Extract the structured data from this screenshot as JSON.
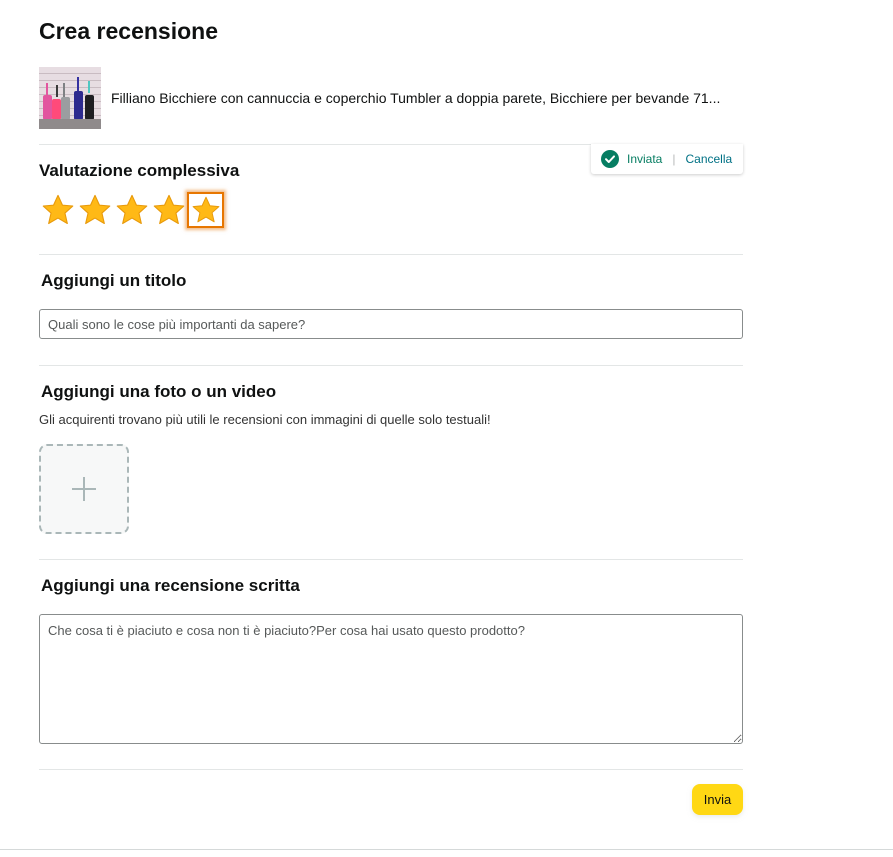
{
  "page": {
    "title": "Crea recensione"
  },
  "product": {
    "name": "Filliano Bicchiere con cannuccia e coperchio Tumbler a doppia parete, Bicchiere per bevande 71..."
  },
  "rating": {
    "title": "Valutazione complessiva",
    "value": 5,
    "max": 5,
    "status": "Inviata",
    "cancel_label": "Cancella",
    "separator": "|"
  },
  "title_section": {
    "heading": "Aggiungi un titolo",
    "placeholder": "Quali sono le cose più importanti da sapere?"
  },
  "media_section": {
    "heading": "Aggiungi una foto o un video",
    "helper": "Gli acquirenti trovano più utili le recensioni con immagini di quelle solo testuali!"
  },
  "written_section": {
    "heading": "Aggiungi una recensione scritta",
    "placeholder": "Che cosa ti è piaciuto e cosa non ti è piaciuto?Per cosa hai usato questo prodotto?"
  },
  "submit": {
    "label": "Invia"
  },
  "icons": {
    "status": "check-circle-icon",
    "upload": "plus-icon",
    "star": "star-icon"
  },
  "colors": {
    "accent": "#ffd814",
    "star": "#ffa41c",
    "success": "#067d62",
    "link": "#007185",
    "focus": "#e77600"
  }
}
